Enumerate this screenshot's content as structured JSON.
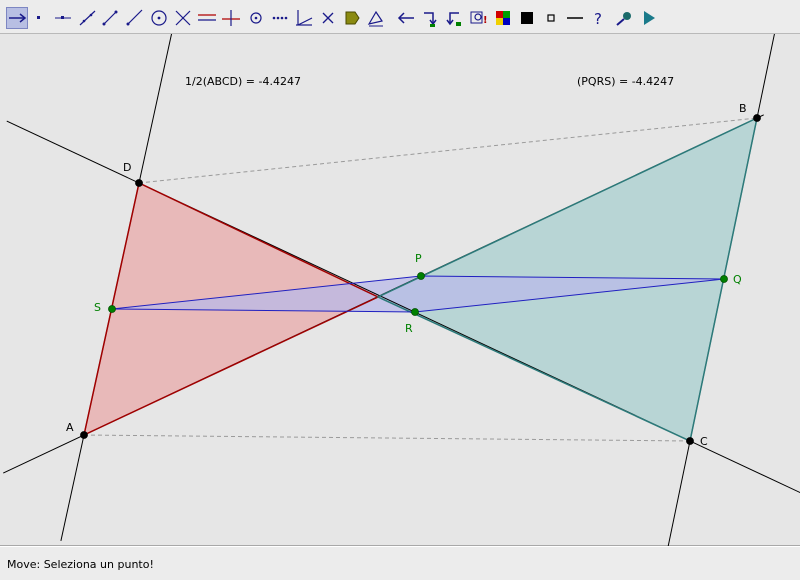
{
  "toolbar": {
    "tools": [
      {
        "icon": "move-arrow-icon",
        "active": true
      },
      {
        "icon": "point-icon"
      },
      {
        "icon": "point-on-object-icon"
      },
      {
        "icon": "line-icon"
      },
      {
        "icon": "segment-icon"
      },
      {
        "icon": "ray-icon"
      },
      {
        "icon": "circle-icon"
      },
      {
        "icon": "intersection-icon"
      },
      {
        "icon": "parallel-line-icon"
      },
      {
        "icon": "perpendicular-line-icon"
      },
      {
        "icon": "midpoint-icon"
      },
      {
        "icon": "dotted-line-icon"
      },
      {
        "icon": "angle-icon"
      },
      {
        "icon": "delete-icon"
      },
      {
        "icon": "polygon-fill-icon"
      },
      {
        "icon": "measure-icon"
      },
      {
        "icon": "arrow-left-icon"
      },
      {
        "icon": "redefine-icon"
      },
      {
        "icon": "redo-icon"
      },
      {
        "icon": "search-icon"
      },
      {
        "icon": "color-palette-icon"
      },
      {
        "icon": "black-square-icon"
      },
      {
        "icon": "small-square-icon"
      },
      {
        "icon": "dash-icon"
      },
      {
        "icon": "help-icon"
      },
      {
        "icon": "magnifier-icon"
      },
      {
        "icon": "play-icon"
      }
    ]
  },
  "canvas": {
    "measure_left": "1/2(ABCD) = -4.4247",
    "measure_right": "(PQRS) = -4.4247",
    "points": [
      {
        "label": "A",
        "color": "#000000"
      },
      {
        "label": "B",
        "color": "#000000"
      },
      {
        "label": "C",
        "color": "#000000"
      },
      {
        "label": "D",
        "color": "#000000"
      },
      {
        "label": "P",
        "color": "#008000"
      },
      {
        "label": "Q",
        "color": "#008000"
      },
      {
        "label": "R",
        "color": "#008000"
      },
      {
        "label": "S",
        "color": "#008000"
      }
    ],
    "colors": {
      "quad_abcd_fill": "#e7b0b0",
      "quad_abcd_stroke": "#a00000",
      "quad_pqrs_fill": "#b9b9e8",
      "quad_pqrs_stroke": "#2020c0",
      "triangle_bc_fill": "#b3d3d3",
      "triangle_bc_stroke": "#2c7a7a",
      "line_color": "#000000",
      "dashed_color": "#9a9a9a",
      "midpoint_color": "#008000"
    }
  },
  "status": {
    "text": "Move: Seleziona un punto!"
  }
}
